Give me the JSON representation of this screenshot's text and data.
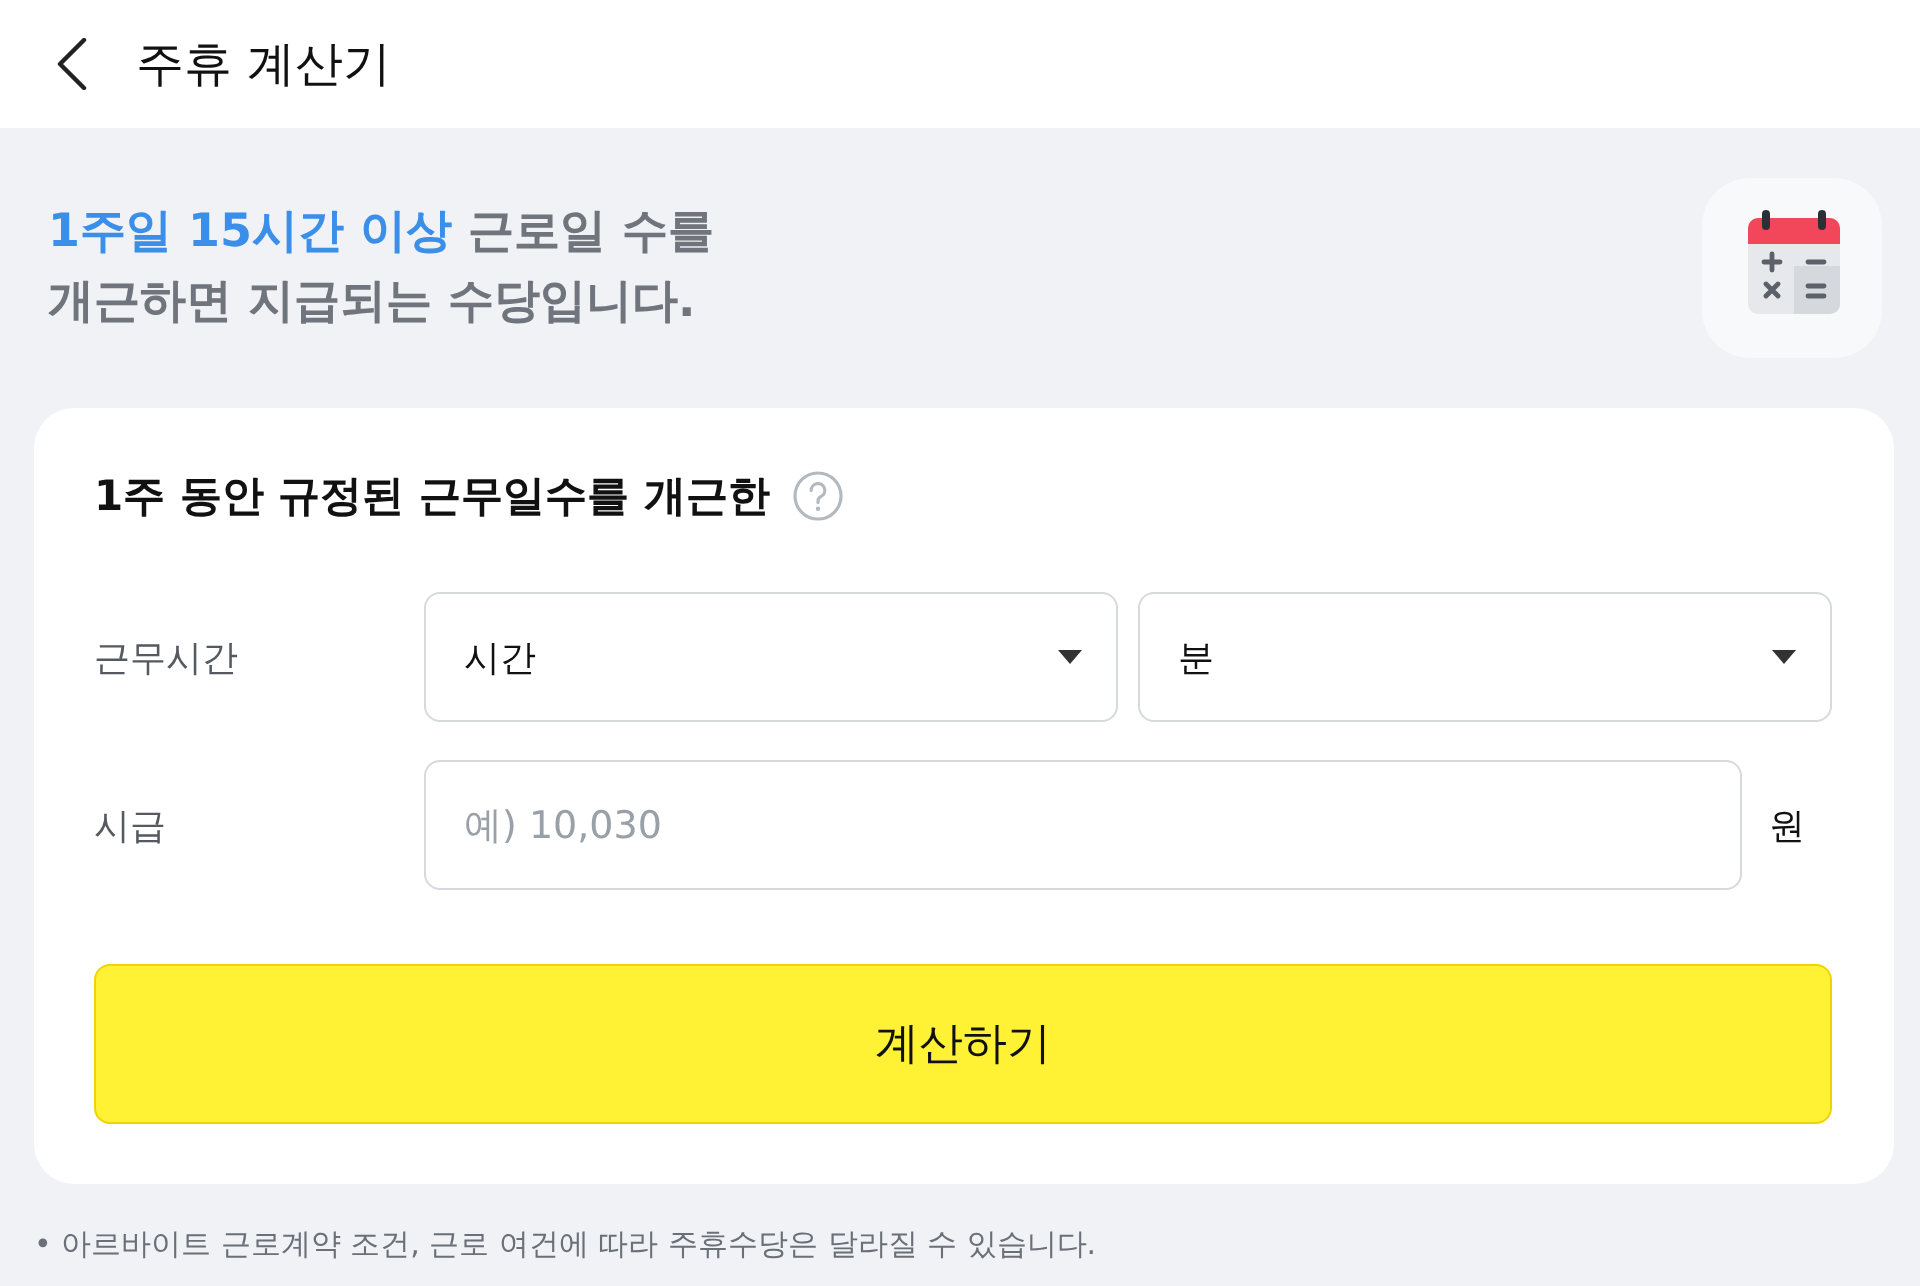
{
  "header": {
    "title": "주휴 계산기"
  },
  "intro": {
    "highlight": "1주일 15시간 이상",
    "lines": [
      "근로일 수를",
      "개근하면 지급되는 수당입니다."
    ]
  },
  "card": {
    "title": "1주 동안 규정된 근무일수를 개근한",
    "work_time": {
      "label": "근무시간",
      "selects": [
        {
          "value": "시간"
        },
        {
          "value": "분"
        }
      ]
    },
    "hourly_wage": {
      "label": "시급",
      "placeholder": "예) 10,030",
      "unit": "원"
    },
    "submit_button": "계산하기"
  },
  "footnote": "• 아르바이트 근로계약 조건, 근로 여건에 따라 주휴수당은 달라질 수 있습니다."
}
